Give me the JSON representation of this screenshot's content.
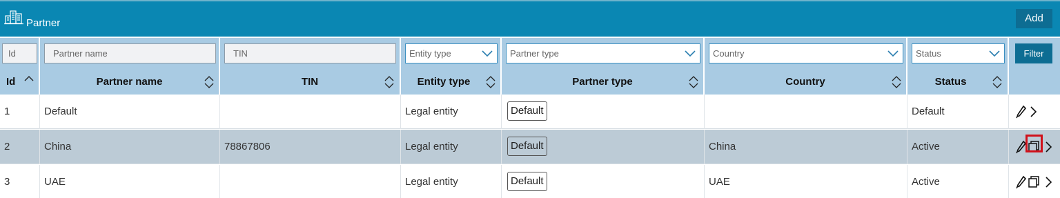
{
  "header": {
    "title": "Partner",
    "logo_icon": "buildings-icon",
    "add_label": "Add"
  },
  "filters": {
    "id_placeholder": "Id",
    "partner_name_placeholder": "Partner name",
    "tin_placeholder": "TIN",
    "entity_type": "Entity type",
    "partner_type": "Partner type",
    "country": "Country",
    "status": "Status",
    "filter_label": "Filter"
  },
  "columns": {
    "id": "Id",
    "partner_name": "Partner name",
    "tin": "TIN",
    "entity_type": "Entity type",
    "partner_type": "Partner type",
    "country": "Country",
    "status": "Status"
  },
  "rows": [
    {
      "id": "1",
      "partner_name": "Default",
      "tin": "",
      "entity_type": "Legal entity",
      "partner_type": "Default",
      "country": "",
      "status": "Default"
    },
    {
      "id": "2",
      "partner_name": "China",
      "tin": "78867806",
      "entity_type": "Legal entity",
      "partner_type": "Default",
      "country": "China",
      "status": "Active"
    },
    {
      "id": "3",
      "partner_name": "UAE",
      "tin": "",
      "entity_type": "Legal entity",
      "partner_type": "Default",
      "country": "UAE",
      "status": "Active"
    }
  ],
  "selected_row": 2,
  "colors": {
    "header_bg": "#0a87b3",
    "table_header_bg": "#a9cbe3",
    "button_bg": "#0d6d93",
    "selected_row_bg": "#bccbd6",
    "highlight": "#d0101a"
  }
}
